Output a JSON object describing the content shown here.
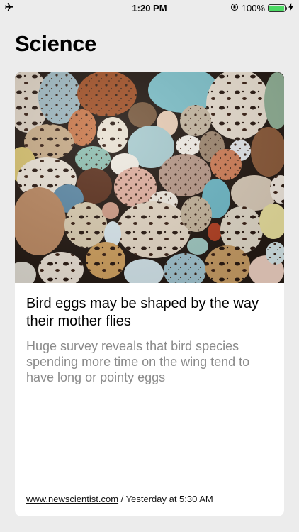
{
  "status_bar": {
    "time": "1:20 PM",
    "battery_percent": "100%",
    "airplane_icon": "airplane-icon",
    "orientation_lock_icon": "orientation-lock-icon",
    "charging_icon": "charging-bolt-icon",
    "battery_color": "#4cd964"
  },
  "section": {
    "title": "Science"
  },
  "article": {
    "image_icon": "bird-eggs-photo",
    "headline": "Bird eggs may be shaped by the way their mother flies",
    "summary": "Huge survey reveals that bird species spending more time on the wing tend to have long or pointy eggs",
    "source": "www.newscientist.com",
    "separator": " / ",
    "timestamp": "Yesterday at 5:30 AM"
  }
}
